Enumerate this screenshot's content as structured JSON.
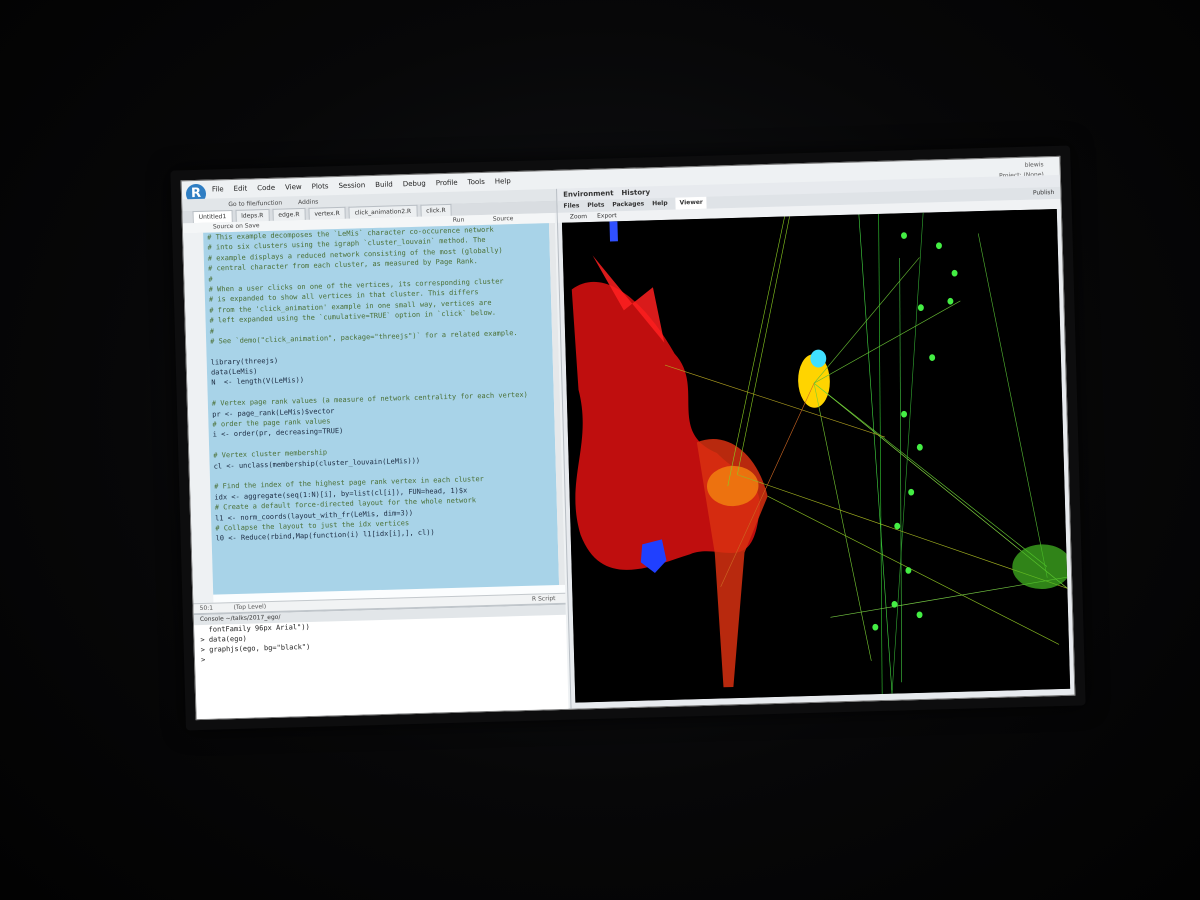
{
  "menu": [
    "File",
    "Edit",
    "Code",
    "View",
    "Plots",
    "Session",
    "Build",
    "Debug",
    "Profile",
    "Tools",
    "Help"
  ],
  "top_right": {
    "user": "blewis",
    "project": "Project: (None)"
  },
  "toolbar": {
    "go_to_file": "Go to file/function",
    "addins": "Addins"
  },
  "editor_tabs": [
    "Untitled1",
    "ldeps.R",
    "edge.R",
    "vertex.R",
    "click_animation2.R",
    "click.R"
  ],
  "editor_bar": {
    "source_on_save": "Source on Save",
    "run": "Run",
    "source": "Source"
  },
  "code_lines": [
    "# This example decomposes the `LeMis` character co-occurence network",
    "# into six clusters using the igraph `cluster_louvain` method. The",
    "# example displays a reduced network consisting of the most (globally)",
    "# central character from each cluster, as measured by Page Rank.",
    "#",
    "# When a user clicks on one of the vertices, its corresponding cluster",
    "# is expanded to show all vertices in that cluster. This differs",
    "# from the 'click_animation' example in one small way, vertices are",
    "# left expanded using the `cumulative=TRUE` option in `click` below.",
    "#",
    "# See `demo(\"click_animation\", package=\"threejs\")` for a related example.",
    "",
    "library(threejs)",
    "data(LeMis)",
    "N  <- length(V(LeMis))",
    "",
    "# Vertex page rank values (a measure of network centrality for each vertex)",
    "pr <- page_rank(LeMis)$vector",
    "# order the page rank values",
    "i <- order(pr, decreasing=TRUE)",
    "",
    "# Vertex cluster membership",
    "cl <- unclass(membership(cluster_louvain(LeMis)))",
    "",
    "# Find the index of the highest page rank vertex in each cluster",
    "idx <- aggregate(seq(1:N)[i], by=list(cl[i]), FUN=head, 1)$x",
    "# Create a default force-directed layout for the whole network",
    "l1 <- norm_coords(layout_with_fr(LeMis, dim=3))",
    "# Collapse the layout to just the idx vertices",
    "l0 <- Reduce(rbind,Map(function(i) l1[idx[i],], cl))",
    ""
  ],
  "editor_status": {
    "position": "50:1",
    "level": "(Top Level)",
    "type": "R Script"
  },
  "console": {
    "title": "Console ~/talks/2017_ego/",
    "lines": [
      "  fontFamily 96px Arial\"))",
      "> data(ego)",
      "> graphjs(ego, bg=\"black\")",
      ">"
    ]
  },
  "right_panel": {
    "env_tabs": [
      "Environment",
      "History"
    ],
    "view_tabs": [
      "Files",
      "Plots",
      "Packages",
      "Help",
      "Viewer"
    ],
    "active_tab": "Viewer",
    "publish": "Publish",
    "viewer_tools": [
      "Zoom",
      "Export"
    ]
  }
}
